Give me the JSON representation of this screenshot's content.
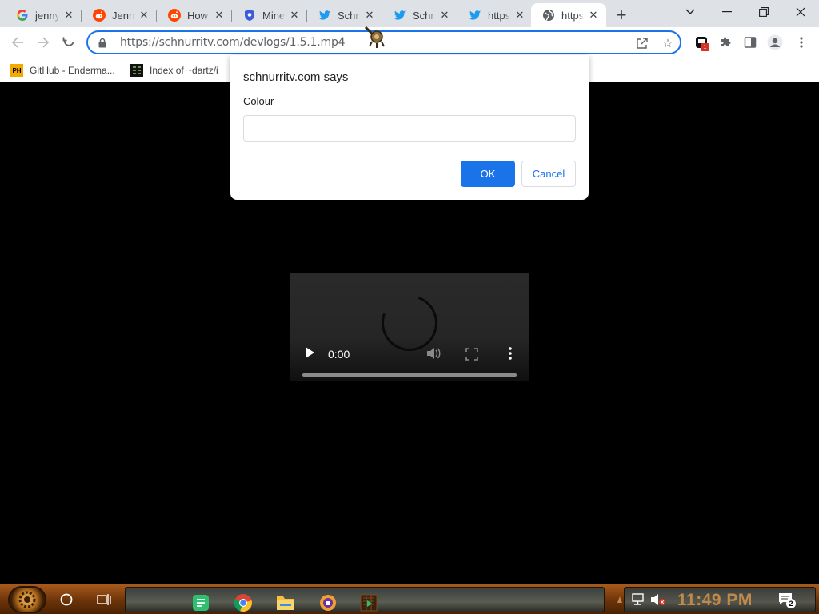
{
  "browser": {
    "tabs": [
      {
        "title": "jenny",
        "favicon": "google-icon",
        "active": false
      },
      {
        "title": "Jenny",
        "favicon": "reddit-icon",
        "active": false
      },
      {
        "title": "How",
        "favicon": "reddit-icon",
        "active": false
      },
      {
        "title": "Mine",
        "favicon": "shield-icon",
        "active": false
      },
      {
        "title": "Schn",
        "favicon": "twitter-icon",
        "active": false
      },
      {
        "title": "Schn",
        "favicon": "twitter-icon",
        "active": false
      },
      {
        "title": "https",
        "favicon": "twitter-icon",
        "active": false
      },
      {
        "title": "https",
        "favicon": "globe-icon",
        "active": true
      }
    ],
    "url": "https://schnurritv.com/devlogs/1.5.1.mp4",
    "extension_badge": "1",
    "bookmarks": [
      {
        "label": "GitHub - Enderma...",
        "favicon_text": "PH"
      },
      {
        "label": "Index of ~dartz/i",
        "favicon_text": ""
      }
    ]
  },
  "dialog": {
    "title": "schnurritv.com says",
    "message": "Colour",
    "input_value": "",
    "ok_label": "OK",
    "cancel_label": "Cancel"
  },
  "video": {
    "time": "0:00"
  },
  "taskbar": {
    "clock": "11:49 PM",
    "notification_count": "2",
    "pinned_apps": [
      "notes-icon",
      "chrome-icon",
      "file-explorer-icon",
      "vpn-icon",
      "media-player-icon"
    ]
  },
  "colors": {
    "accent": "#1a73e8",
    "taskbar": "#6b3308",
    "clock": "#c08a4a"
  }
}
